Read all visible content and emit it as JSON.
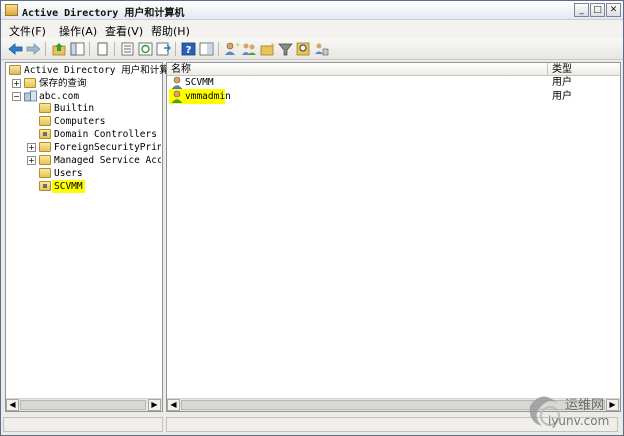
{
  "window": {
    "title": "Active Directory 用户和计算机",
    "minimize": "_",
    "maximize": "□",
    "close": "✕"
  },
  "menu": {
    "items": [
      "文件(F)",
      "操作(A)",
      "查看(V)",
      "帮助(H)"
    ]
  },
  "tree": {
    "root": "Active Directory 用户和计算机",
    "saved_queries": "保存的查询",
    "domain": "abc.com",
    "children": [
      "Builtin",
      "Computers",
      "Domain Controllers",
      "ForeignSecurityPrincipals",
      "Managed Service Accounts",
      "Users",
      "SCVMM"
    ],
    "selected": "SCVMM"
  },
  "list": {
    "columns": [
      "名称",
      "类型"
    ],
    "rows": [
      {
        "name": "SCVMM",
        "type": "用户"
      },
      {
        "name": "vmmadmin",
        "type": "用户"
      }
    ]
  },
  "watermark": {
    "cn": "运维网",
    "en": "iyunv.com"
  },
  "colors": {
    "highlight": "#ffff00",
    "folder": "#e7c35a",
    "window_border": "#5a6e8c"
  }
}
